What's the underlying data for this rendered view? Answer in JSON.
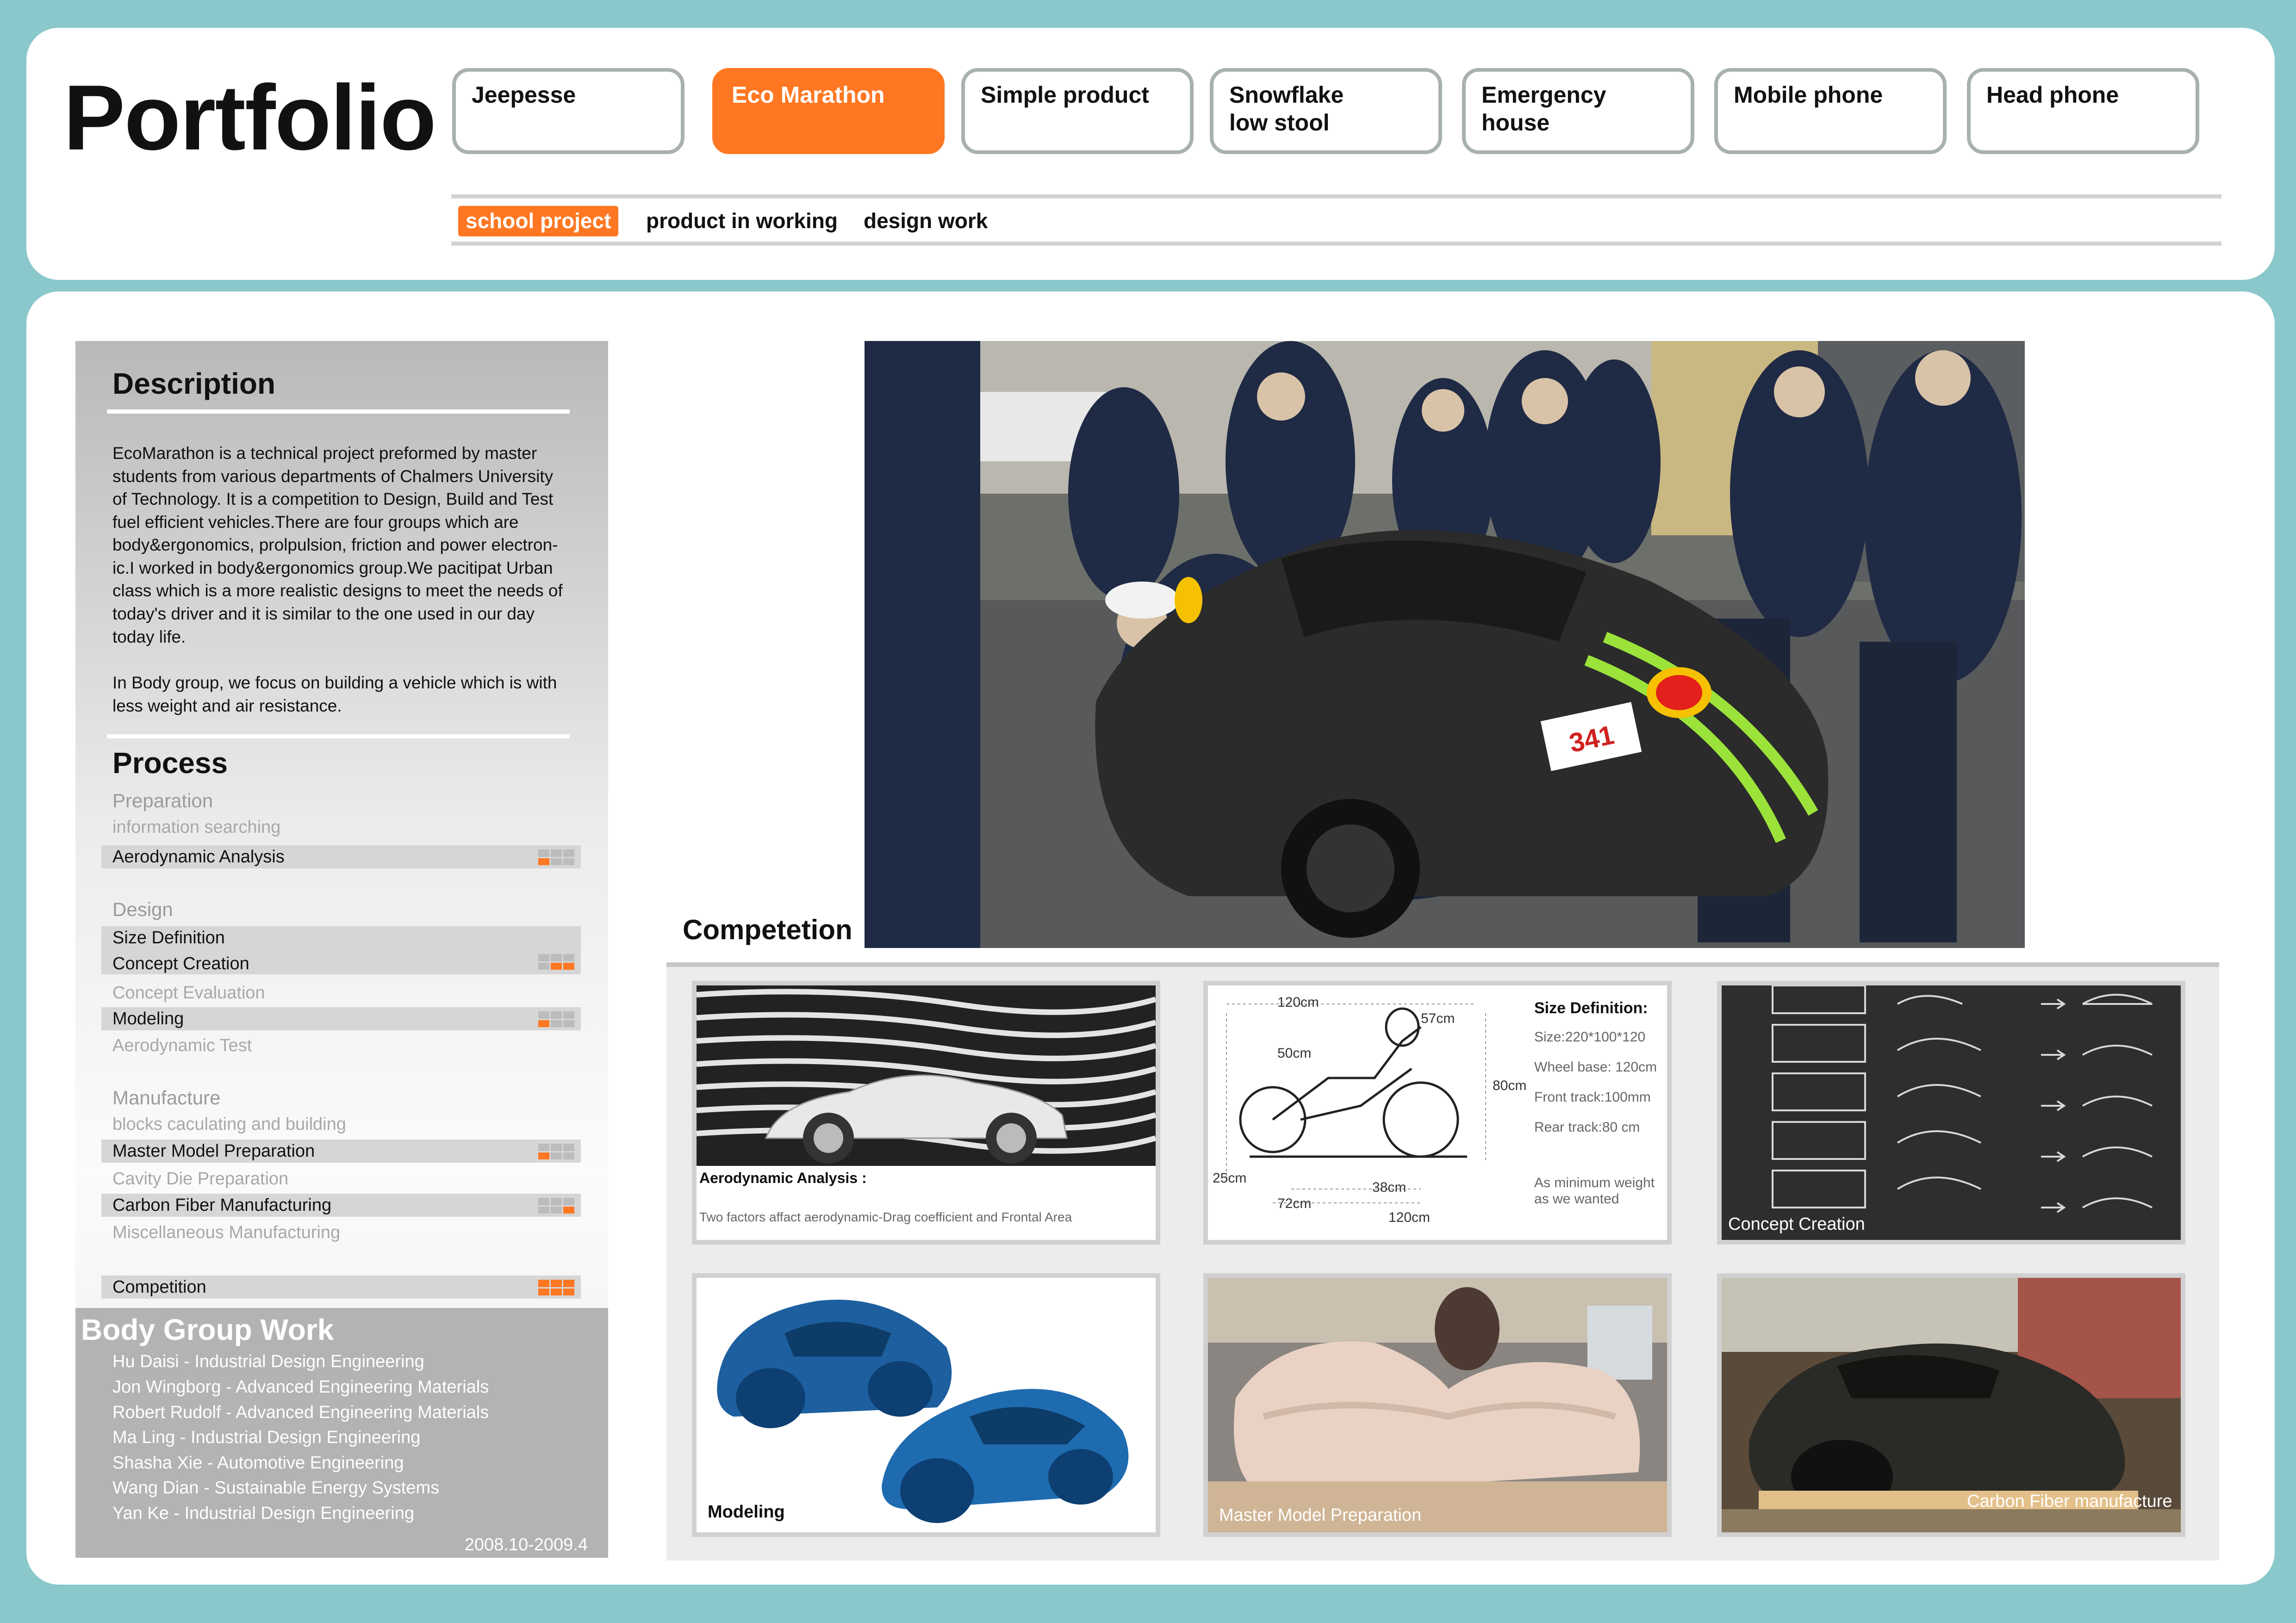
{
  "header": {
    "brand": "Portfolio",
    "project_tabs": [
      "Jeepesse",
      "Eco Marathon",
      "Simple product",
      "Snowflake\n low stool",
      "Emergency\n house",
      "Mobile phone",
      "Head phone"
    ],
    "active_project": "Eco Marathon",
    "categories": [
      "school project",
      "product in working",
      "design work"
    ],
    "active_category": "school project"
  },
  "description": {
    "title": "Description",
    "paragraph1": "EcoMarathon is a technical project preformed by master\nstudents from various departments of Chalmers University\nof Technology. It is a competition to Design, Build and Test\nfuel efficient vehicles.There are four groups which are\nbody&ergonomics, prolpulsion, friction and power electron-\nic.I worked in body&ergonomics group.We pacitipat Urban\nclass which is a more realistic designs to meet the needs of\ntoday's driver and it is similar to the one used in our day\ntoday life.",
    "paragraph2": "In Body group, we focus on building a vehicle which is with\nless weight and air resistance."
  },
  "process": {
    "title": "Process",
    "preparation": {
      "title": "Preparation",
      "item1": "information searching",
      "item2": "Aerodynamic Analysis"
    },
    "design": {
      "title": "Design",
      "item1": "Size Definition",
      "item2": "Concept Creation",
      "item3": "Concept Evaluation",
      "item4": "Modeling",
      "item5": "Aerodynamic  Test"
    },
    "manufacture": {
      "title": "Manufacture",
      "item1": "blocks caculating and building",
      "item2": "Master Model Preparation",
      "item3": "Cavity Die Preparation",
      "item4": "Carbon Fiber Manufacturing",
      "item5": "Miscellaneous Manufacturing"
    },
    "competition": "Competition"
  },
  "team": {
    "title": "Body Group Work",
    "members": [
      "Hu Daisi - Industrial Design Engineering",
      "Jon Wingborg - Advanced Engineering Materials",
      "Robert Rudolf - Advanced Engineering Materials",
      "Ma Ling - Industrial Design Engineering",
      "Shasha Xie - Automotive Engineering",
      "Wang Dian - Sustainable Energy Systems",
      "Yan Ke - Industrial Design Engineering"
    ],
    "date_range": "2008.10-2009.4"
  },
  "competition_title": "Competetion",
  "hero_car_number": "341",
  "gallery": {
    "aero": {
      "label": "Aerodynamic Analysis :",
      "caption": "Two factors affact aerodynamic-Drag coefficient and Frontal Area"
    },
    "size": {
      "title": "Size Definition:",
      "size": "Size:220*100*120",
      "wheelbase": "Wheel base: 120cm",
      "front": "Front track:100mm",
      "rear": "Rear track:80 cm",
      "note1": "As minimum weight",
      "note2": "as we wanted",
      "dim_120a": "120cm",
      "dim_57": "57cm",
      "dim_50": "50cm",
      "dim_80": "80cm",
      "dim_25": "25cm",
      "dim_38": "38cm",
      "dim_72": "72cm",
      "dim_120b": "120cm"
    },
    "concept": {
      "label": "Concept Creation"
    },
    "modeling": {
      "label": "Modeling"
    },
    "master": {
      "label": "Master Model Preparation"
    },
    "carbon": {
      "label": "Carbon Fiber manufacture"
    }
  },
  "colors": {
    "accent": "#ff7722",
    "frame": "#8ac8cb"
  }
}
